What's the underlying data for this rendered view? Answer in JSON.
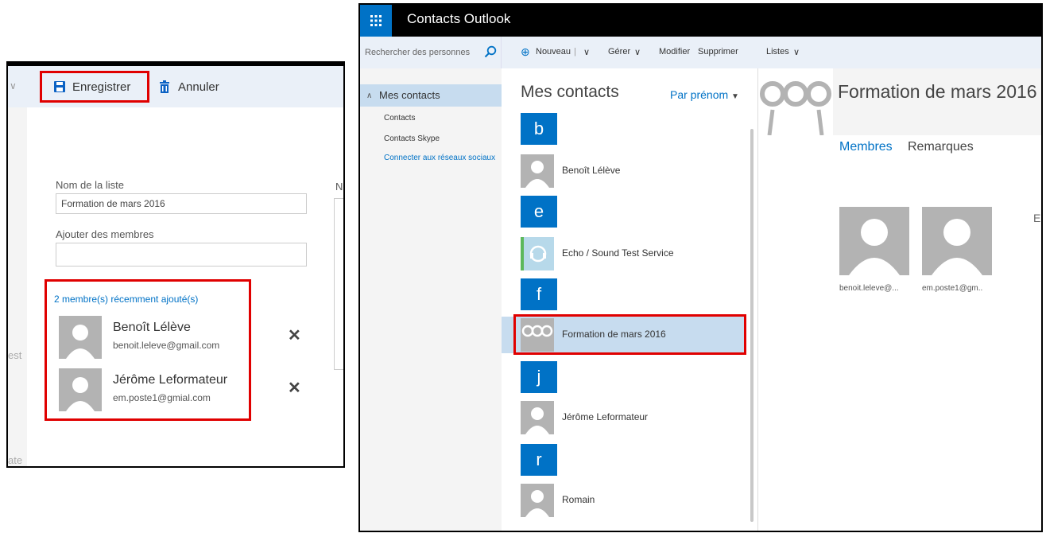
{
  "left_panel": {
    "toolbar": {
      "save_label": "Enregistrer",
      "cancel_label": "Annuler"
    },
    "list_name_label": "Nom de la liste",
    "list_name_value": "Formation de mars 2016",
    "add_members_label": "Ajouter des membres",
    "add_members_value": "",
    "side_label_fragment": "N",
    "left_fragment_1": "est",
    "left_fragment_2": "ate",
    "recent_title": "2 membre(s) récemment ajouté(s)",
    "members": [
      {
        "name": "Benoît Lélève",
        "email": "benoit.leleve@gmail.com",
        "remove": "✕"
      },
      {
        "name": "Jérôme Leformateur",
        "email": "em.poste1@gmial.com",
        "remove": "✕"
      }
    ]
  },
  "outlook": {
    "app_title": "Contacts Outlook",
    "search_placeholder": "Rechercher des personnes",
    "commands": {
      "new": "Nouveau",
      "manage": "Gérer",
      "edit": "Modifier",
      "delete": "Supprimer",
      "lists": "Listes"
    },
    "nav": {
      "selected": "Mes contacts",
      "items": [
        "Contacts",
        "Contacts Skype"
      ],
      "link": "Connecter aux réseaux sociaux"
    },
    "list": {
      "title": "Mes contacts",
      "sort": "Par prénom",
      "groups": [
        {
          "letter": "b",
          "contacts": [
            "Benoît Lélève"
          ]
        },
        {
          "letter": "e",
          "contacts": [
            "Echo / Sound Test Service"
          ]
        },
        {
          "letter": "f",
          "contacts": [
            "Formation de mars 2016"
          ]
        },
        {
          "letter": "j",
          "contacts": [
            "Jérôme Leformateur"
          ]
        },
        {
          "letter": "r",
          "contacts": [
            "Romain"
          ]
        }
      ]
    },
    "detail": {
      "title": "Formation de mars 2016",
      "tabs": [
        "Membres",
        "Remarques"
      ],
      "members": [
        "benoit.leleve@...",
        "em.poste1@gm.."
      ],
      "fragment": "E"
    },
    "colors": {
      "accent": "#0072c6",
      "highlight": "#e00000",
      "selected_row": "#c7dcef"
    }
  }
}
